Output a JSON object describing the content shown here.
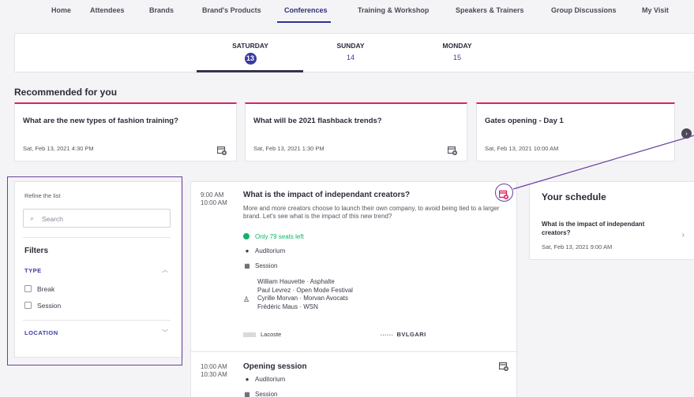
{
  "nav": {
    "items": [
      {
        "label": "Home"
      },
      {
        "label": "Attendees"
      },
      {
        "label": "Brands"
      },
      {
        "label": "Brand's Products"
      },
      {
        "label": "Conferences"
      },
      {
        "label": "Training & Workshop"
      },
      {
        "label": "Speakers & Trainers"
      },
      {
        "label": "Group Discussions"
      },
      {
        "label": "My Visit"
      }
    ],
    "active": "Conferences"
  },
  "days": [
    {
      "name": "SATURDAY",
      "num": "13"
    },
    {
      "name": "SUNDAY",
      "num": "14"
    },
    {
      "name": "MONDAY",
      "num": "15"
    }
  ],
  "recommended": {
    "title": "Recommended for you",
    "cards": [
      {
        "title": "What are the new types of fashion training?",
        "date": "Sat, Feb 13, 2021 4:30 PM"
      },
      {
        "title": "What will be 2021 flashback trends?",
        "date": "Sat, Feb 13, 2021 1:30 PM"
      },
      {
        "title": "Gates opening - Day 1",
        "date": "Sat, Feb 13, 2021 10:00 AM"
      }
    ]
  },
  "filters": {
    "refine_label": "Refine the list",
    "search_placeholder": "Search",
    "title": "Filters",
    "type_label": "TYPE",
    "options": [
      "Break",
      "Session"
    ],
    "location_label": "LOCATION"
  },
  "sessions": [
    {
      "start": "9:00 AM",
      "end": "10:00 AM",
      "title": "What is the impact of independant creators?",
      "description": "More and more creators choose to launch their own company, to avoid being tied to a larger brand. Let's see what is the impact of this new trend?",
      "seats": "Only 79 seats left",
      "location": "Auditorium",
      "type": "Session",
      "speakers": [
        "William Hauvette · Asphalte",
        "Paul Levrez · Open Mode Festival",
        "Cyrille Morvan · Morvan Avocats",
        "Frédéric Maus · WSN"
      ],
      "brands": [
        "Lacoste",
        "BVLGARI"
      ]
    },
    {
      "start": "10:00 AM",
      "end": "10:30 AM",
      "title": "Opening session",
      "location": "Auditorium",
      "type": "Session"
    }
  ],
  "schedule": {
    "heading": "Your schedule",
    "item_title": "What is the impact of independant creators?",
    "item_date": "Sat, Feb 13, 2021 9:00 AM"
  },
  "colors": {
    "accent": "#3a3aa0",
    "pink": "#d9245f",
    "green": "#18b06a",
    "annotation": "#6b3fa0"
  }
}
